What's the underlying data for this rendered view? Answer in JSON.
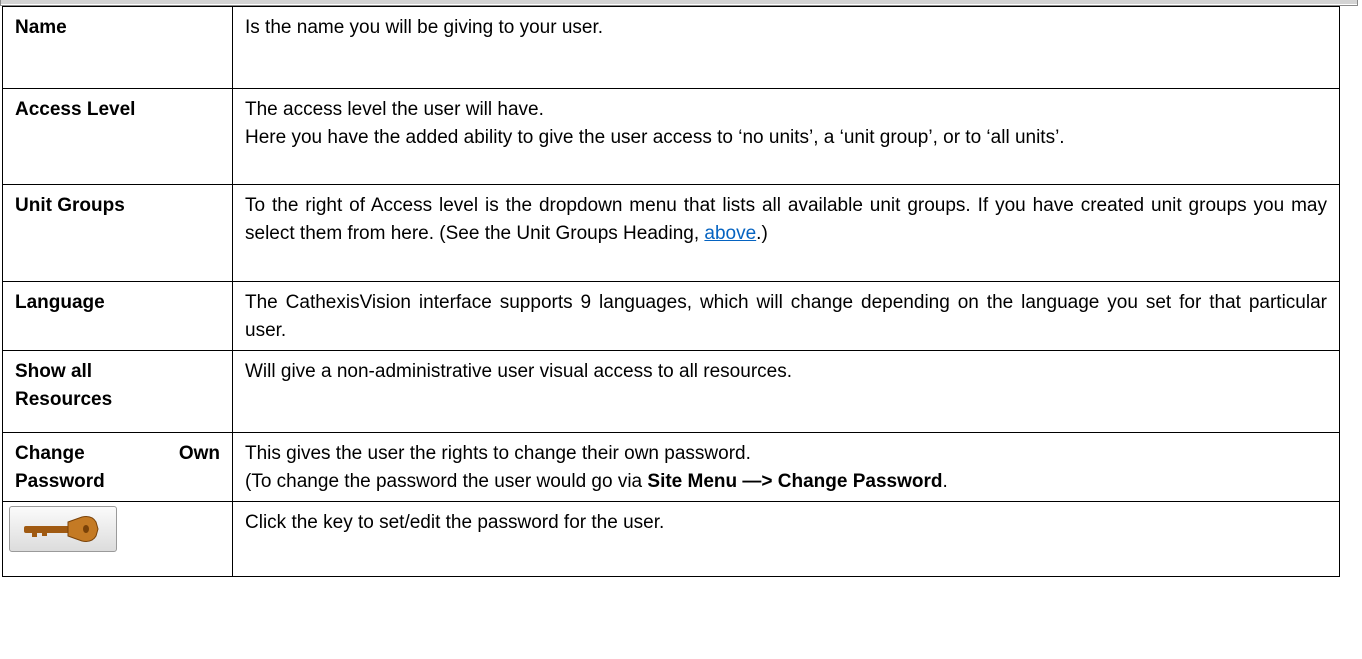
{
  "rows": [
    {
      "term": "Name",
      "desc": [
        "Is the name you will be giving to your user."
      ]
    },
    {
      "term": "Access Level",
      "desc": [
        "The access level the user will have.",
        "Here you have the added ability to give the user access to ‘no units’, a ‘unit group’, or to ‘all units’."
      ]
    },
    {
      "term": "Unit Groups",
      "desc_before_link": "To the right of Access level is the dropdown menu that lists all available unit groups. If you have created unit groups you may select them from here. (See the Unit Groups Heading, ",
      "link_text": "above",
      "desc_after_link": ".)"
    },
    {
      "term": "Language",
      "desc": [
        "The CathexisVision interface supports 9 languages, which will change depending on the language you set for that particular user."
      ]
    },
    {
      "term_lines": [
        "Show all",
        "Resources"
      ],
      "desc": [
        "Will give a non-administrative user visual access to all resources."
      ]
    },
    {
      "term_parts": [
        "Change",
        "Own",
        "Password"
      ],
      "desc_line1": "This gives the user the rights to change their own password.",
      "desc_line2_prefix": "(To change the password the user would go via ",
      "desc_line2_bold": "Site Menu —> Change Password",
      "desc_line2_suffix": "."
    },
    {
      "icon": "key-icon",
      "desc": [
        "Click the key to set/edit the password for the user."
      ]
    }
  ]
}
